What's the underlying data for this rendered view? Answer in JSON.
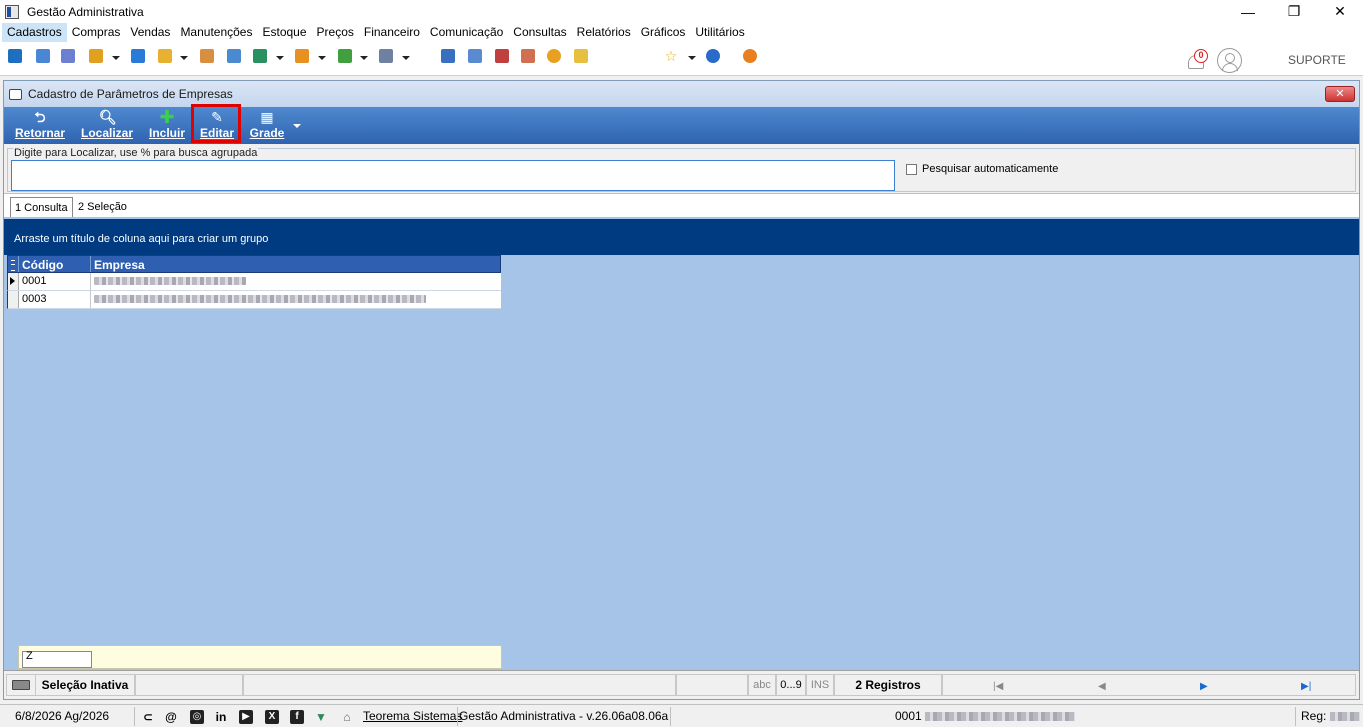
{
  "window": {
    "title": "Gestão Administrativa",
    "min": "—",
    "restore": "❐",
    "close": "✕"
  },
  "menu": [
    "Cadastros",
    "Compras",
    "Vendas",
    "Manutenções",
    "Estoque",
    "Preços",
    "Financeiro",
    "Comunicação",
    "Consultas",
    "Relatórios",
    "Gráficos",
    "Utilitários"
  ],
  "toolbar": {
    "notification_count": "0",
    "user_label": "SUPORTE"
  },
  "form": {
    "title": "Cadastro de Parâmetros de Empresas",
    "close": "✕",
    "actions": {
      "retornar": "Retornar",
      "localizar": "Localizar",
      "incluir": "Incluir",
      "editar": "Editar",
      "grade": "Grade"
    },
    "search": {
      "legend": "Digite para Localizar, use % para busca agrupada",
      "value": "",
      "auto_label": "Pesquisar automaticamente"
    },
    "tabs": [
      "1 Consulta",
      "2 Seleção"
    ],
    "group_hint": "Arraste um título de coluna aqui para criar um grupo",
    "grid": {
      "columns": [
        "Código",
        "Empresa"
      ],
      "rows": [
        {
          "codigo": "0001"
        },
        {
          "codigo": "0003"
        }
      ]
    },
    "filter_value": "Z",
    "status": {
      "selecao": "Seleção Inativa",
      "abc": "abc",
      "digits": "0...9",
      "ins": "INS",
      "registros": "2 Registros"
    }
  },
  "footer": {
    "date": "6/8/2026 Ag/2026",
    "company": "Teorema Sistemas",
    "version": "Gestão Administrativa - v.26.06a08.06a",
    "code": "0001",
    "reg": "Reg:"
  },
  "colors": {
    "accent": "#2f63b0",
    "highlight": "#e00000",
    "grid_bg": "#a6c4e8",
    "group_panel": "#003a80"
  }
}
